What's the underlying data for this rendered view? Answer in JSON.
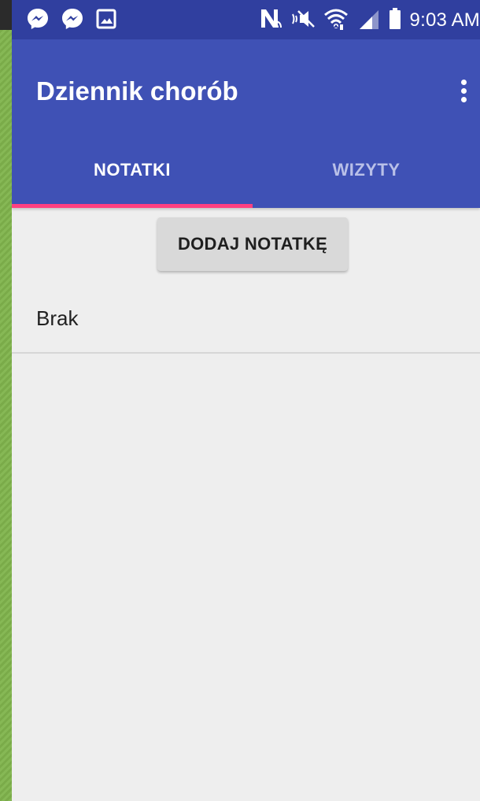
{
  "status_bar": {
    "time": "9:03 AM",
    "left_icons": [
      "messenger-icon",
      "messenger-icon",
      "gallery-icon"
    ],
    "right_icons": [
      "nfc-icon",
      "mute-icon",
      "wifi-icon",
      "signal-icon",
      "battery-icon"
    ]
  },
  "app_bar": {
    "title": "Dziennik chorób",
    "menu_icon": "more-vertical-icon"
  },
  "tabs": [
    {
      "label": "NOTATKI",
      "selected": true
    },
    {
      "label": "WIZYTY",
      "selected": false
    }
  ],
  "main": {
    "add_button_label": "DODAJ NOTATKĘ",
    "items": [
      {
        "text": "Brak"
      }
    ]
  },
  "colors": {
    "status_bar": "#303f9f",
    "primary": "#3f51b5",
    "accent": "#ff4081",
    "background": "#eeeeee"
  }
}
